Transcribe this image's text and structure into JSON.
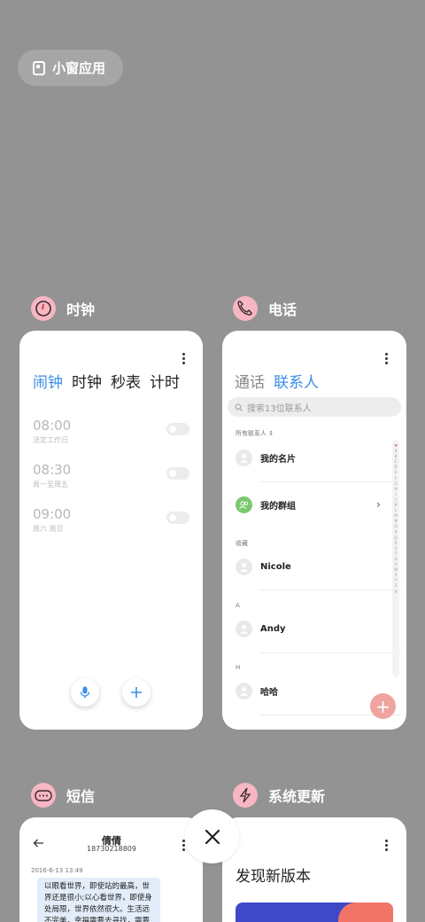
{
  "small_window": {
    "label": "小窗应用",
    "icon": "small-window-icon"
  },
  "apps": {
    "clock": {
      "name": "时钟",
      "icon": "clock-icon",
      "tabs": [
        "闹钟",
        "时钟",
        "秒表",
        "计时"
      ],
      "active_tab": "闹钟",
      "alarms": [
        {
          "time": "08:00",
          "repeat": "法定工作日",
          "enabled": false
        },
        {
          "time": "08:30",
          "repeat": "周一至周五",
          "enabled": false
        },
        {
          "time": "09:00",
          "repeat": "周六 周日",
          "enabled": false
        }
      ]
    },
    "phone": {
      "name": "电话",
      "icon": "phone-icon",
      "tabs": [
        "通话",
        "联系人"
      ],
      "active_tab": "联系人",
      "search_placeholder": "搜索13位联系人",
      "all_contacts_label": "所有联系人",
      "my_card": "我的名片",
      "my_groups": "我的群组",
      "favorites_label": "收藏",
      "favorite_contact": "Nicole",
      "section_a": "A",
      "contact_a": "Andy",
      "section_h": "H",
      "contact_h": "哈哈",
      "alphabet": [
        "♥",
        "A",
        "B",
        "C",
        "D",
        "E",
        "F",
        "G",
        "H",
        "I",
        "J",
        "K",
        "L",
        "M",
        "N",
        "O",
        "P",
        "Q",
        "R",
        "S",
        "T",
        "U",
        "V",
        "W",
        "X",
        "Y",
        "Z",
        "#"
      ],
      "fab_label": "+"
    },
    "sms": {
      "name": "短信",
      "icon": "sms-icon",
      "contact_name": "倩倩",
      "contact_number": "18730218809",
      "date": "2016-6-13 13:49",
      "message": "以眼看世界，即使站的最高，世界还是很小;以心看世界，即使身处局限，世界依然很大。生活远不完美，幸福需要去寻找，需要用心去体会。"
    },
    "update": {
      "name": "系统更新",
      "icon": "update-icon",
      "title": "发现新版本"
    }
  },
  "close_button": {
    "icon": "close-icon"
  },
  "colors": {
    "background": "#939393",
    "accent": "#3a8ee6",
    "fab": "#f0a49f",
    "banner_blue": "#3f49c8",
    "banner_pink": "#f27468"
  }
}
